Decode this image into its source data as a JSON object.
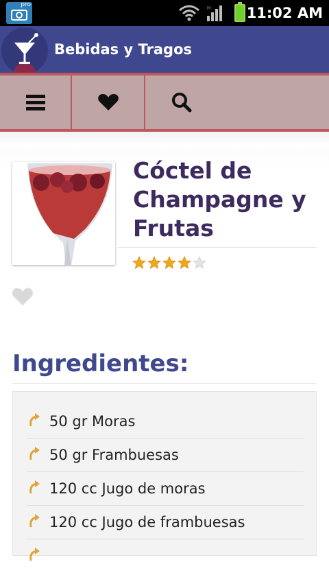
{
  "status_bar": {
    "time": "11:02 AM",
    "camera_badge": "pro"
  },
  "app": {
    "title": "Bebidas y Tragos"
  },
  "recipe": {
    "title": "Cóctel de Champagne y Frutas",
    "rating": 4,
    "rating_max": 5
  },
  "ingredients": {
    "heading": "Ingredientes:",
    "items": [
      "50 gr Moras",
      "50 gr Frambuesas",
      "120 cc Jugo de moras",
      "120 cc Jugo de frambuesas"
    ]
  },
  "colors": {
    "action_bar": "#3f478f",
    "toolbar": "#bfa5a5",
    "toolbar_border": "#c0575b",
    "title": "#3d2a5e",
    "heading": "#40488e",
    "star": "#f0a818"
  }
}
